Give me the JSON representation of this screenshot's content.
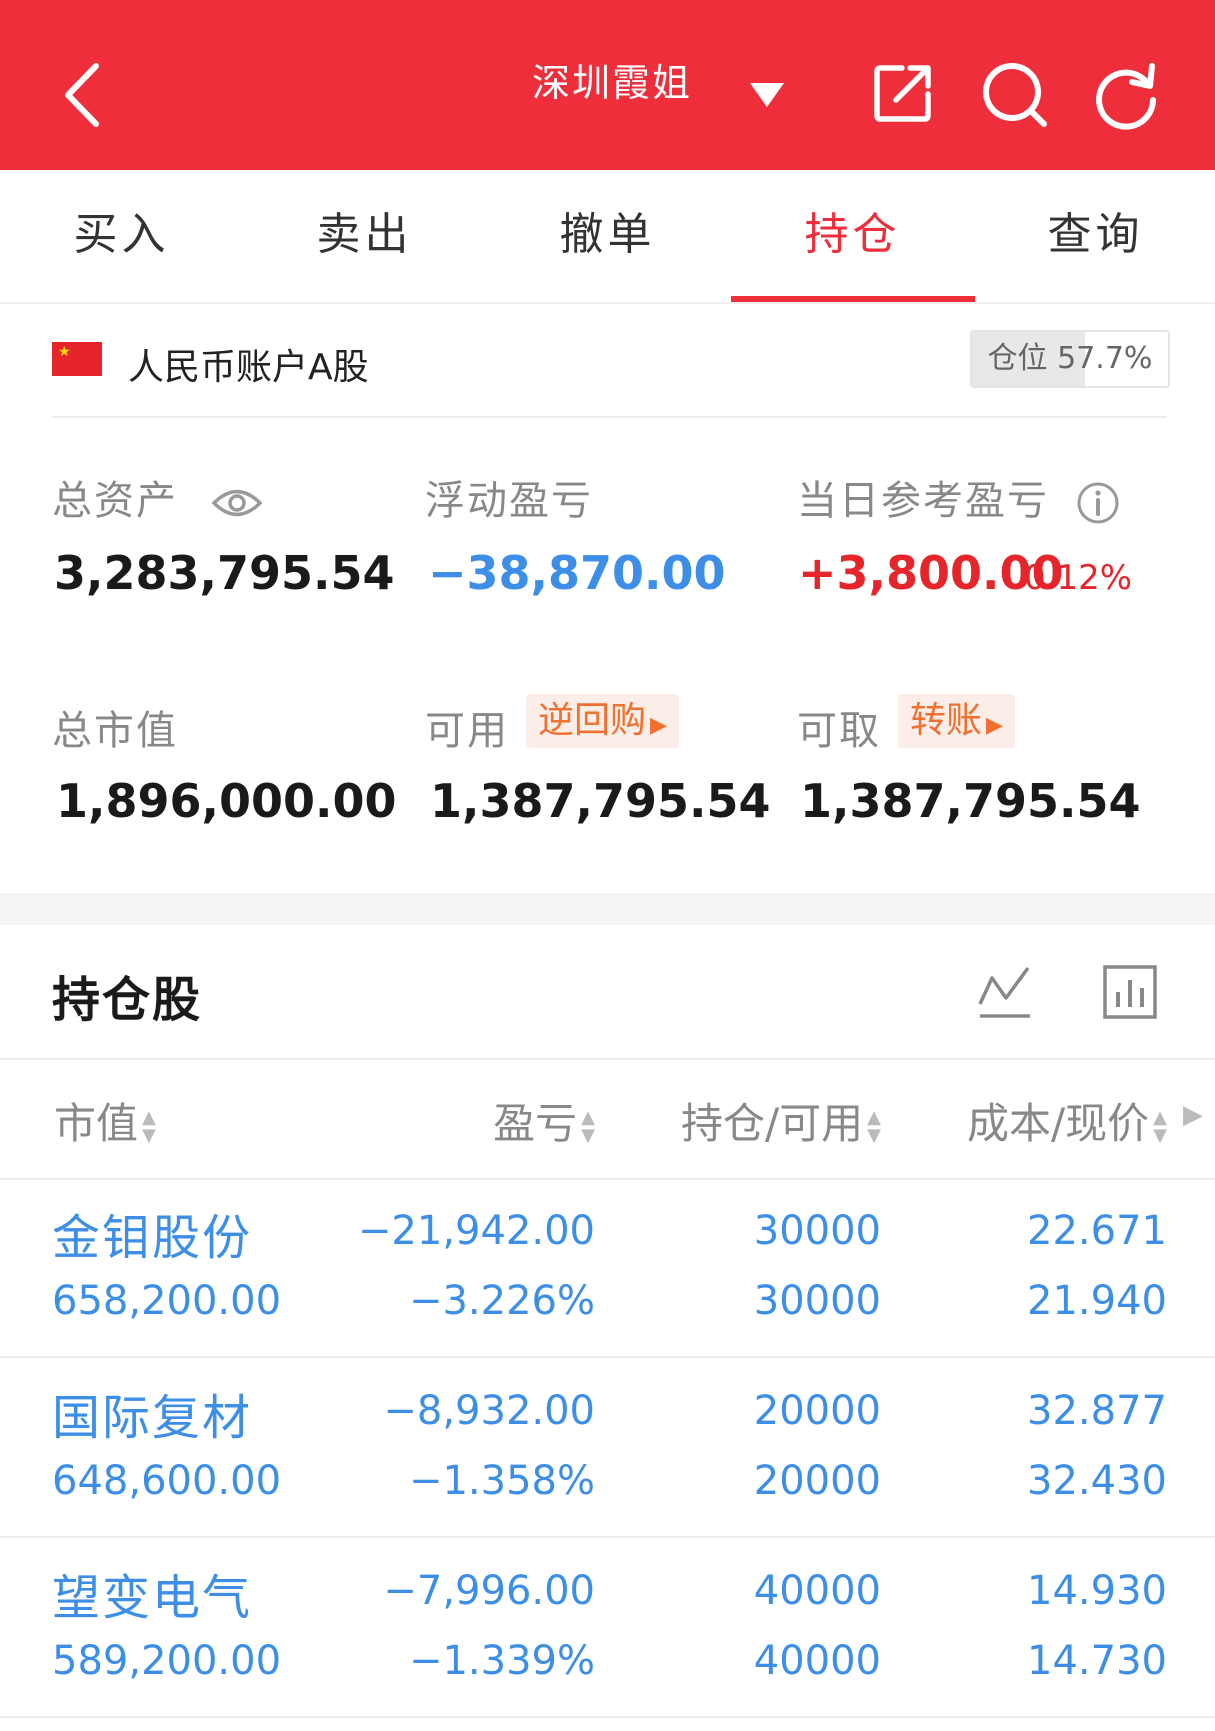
{
  "header": {
    "title": "深圳霞姐",
    "icons": [
      "back-icon",
      "dropdown-triangle-icon",
      "share-icon",
      "search-icon",
      "refresh-icon"
    ]
  },
  "tabs": [
    {
      "label": "买入",
      "active": false
    },
    {
      "label": "卖出",
      "active": false
    },
    {
      "label": "撤单",
      "active": false
    },
    {
      "label": "持仓",
      "active": true
    },
    {
      "label": "查询",
      "active": false
    }
  ],
  "account": {
    "label": "人民币账户A股",
    "position_label": "仓位",
    "position_value": "57.7%",
    "position_fraction": 0.577
  },
  "stats": {
    "total_assets_label": "总资产",
    "total_assets": "3,283,795.54",
    "floating_pl_label": "浮动盈亏",
    "floating_pl": "−38,870.00",
    "daily_pl_label": "当日参考盈亏",
    "daily_pl": "+3,800.00",
    "daily_pl_pct": "0.12%",
    "market_value_label": "总市值",
    "market_value": "1,896,000.00",
    "available_label": "可用",
    "reverse_repo_label": "逆回购",
    "available": "1,387,795.54",
    "withdrawable_label": "可取",
    "transfer_label": "转账",
    "withdrawable": "1,387,795.54"
  },
  "holdings": {
    "title": "持仓股",
    "columns": [
      "市值",
      "盈亏",
      "持仓/可用",
      "成本/现价"
    ],
    "rows": [
      {
        "name": "金钼股份",
        "market_value": "658,200.00",
        "pl": "−21,942.00",
        "pl_pct": "−3.226%",
        "hold": "30000",
        "available": "30000",
        "cost": "22.671",
        "price": "21.940"
      },
      {
        "name": "国际复材",
        "market_value": "648,600.00",
        "pl": "−8,932.00",
        "pl_pct": "−1.358%",
        "hold": "20000",
        "available": "20000",
        "cost": "32.877",
        "price": "32.430"
      },
      {
        "name": "望变电气",
        "market_value": "589,200.00",
        "pl": "−7,996.00",
        "pl_pct": "−1.339%",
        "hold": "40000",
        "available": "40000",
        "cost": "14.930",
        "price": "14.730"
      }
    ]
  },
  "colors": {
    "brand_red": "#ef2e3b",
    "loss_blue": "#3c8ee6",
    "gain_red": "#e6252b",
    "accent_orange": "#f2702f"
  }
}
